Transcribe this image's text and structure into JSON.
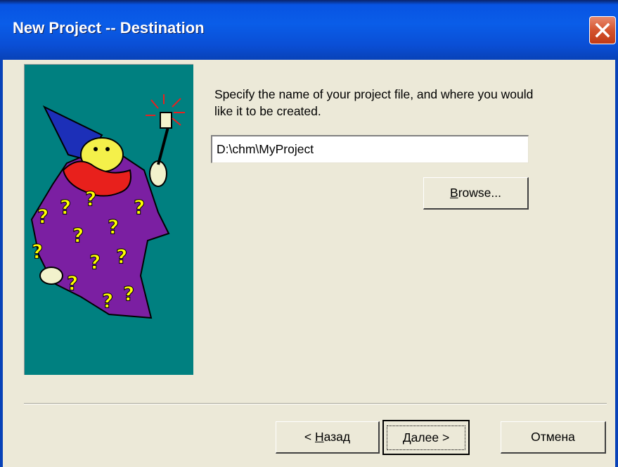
{
  "window": {
    "title": "New Project -- Destination"
  },
  "instruction": "Specify the name of your project file, and where you would like it to be created.",
  "path_field": {
    "value": "D:\\chm\\MyProject"
  },
  "buttons": {
    "browse": {
      "mnemonic": "B",
      "rest": "rowse..."
    },
    "back": {
      "prefix": "< ",
      "mnemonic": "Н",
      "rest": "азад"
    },
    "next": {
      "mnemonic": "Д",
      "rest": "алее >"
    },
    "cancel": "Отмена"
  },
  "colors": {
    "titlebar": "#0a5de8",
    "panel": "#008080",
    "dialog": "#ece9d8",
    "robe": "#7b1fa2",
    "hat": "#1c2fb8",
    "beard": "#e8201c"
  },
  "illustration": {
    "icon": "wizard-with-wand-icon"
  }
}
